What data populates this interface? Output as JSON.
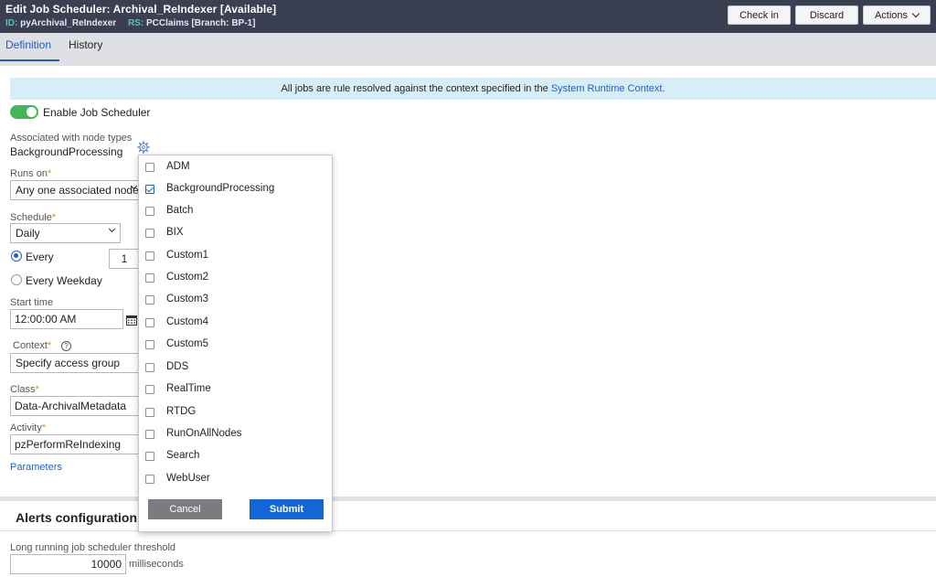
{
  "header": {
    "title": "Edit  Job Scheduler: Archival_ReIndexer [Available]",
    "id_label": "ID:",
    "id_value": "pyArchival_ReIndexer",
    "rs_label": "RS:",
    "rs_value": "PCClaims [Branch: BP-1]",
    "buttons": {
      "check_in": "Check in",
      "discard": "Discard",
      "actions": "Actions"
    }
  },
  "tabs": [
    {
      "label": "Definition",
      "active": true
    },
    {
      "label": "History",
      "active": false
    }
  ],
  "info_bar": {
    "text": "All jobs are rule resolved against the context specified in the ",
    "link": "System Runtime Context."
  },
  "form": {
    "enable_label": "Enable Job Scheduler",
    "node_types_label": "Associated with node types",
    "node_types_value": "BackgroundProcessing",
    "runs_on_label": "Runs on",
    "runs_on_value": "Any one associated node",
    "schedule_label": "Schedule",
    "schedule_value": "Daily",
    "every_label": "Every",
    "every_value": "1",
    "every_weekday_label": "Every Weekday",
    "start_time_label": "Start time",
    "start_time_value": "12:00:00 AM",
    "context_label": "Context",
    "context_help": "?",
    "context_value": "Specify access group",
    "class_label": "Class",
    "class_value": "Data-ArchivalMetadata",
    "activity_label": "Activity",
    "activity_value": "pzPerformReIndexing",
    "parameters_link": "Parameters",
    "required_mark": "*"
  },
  "alerts": {
    "title": "Alerts configuration",
    "threshold_label": "Long running job scheduler threshold",
    "threshold_value": "10000",
    "threshold_unit": "milliseconds"
  },
  "node_dropdown": {
    "options": [
      {
        "label": "ADM",
        "checked": false
      },
      {
        "label": "BackgroundProcessing",
        "checked": true
      },
      {
        "label": "Batch",
        "checked": false
      },
      {
        "label": "BIX",
        "checked": false
      },
      {
        "label": "Custom1",
        "checked": false
      },
      {
        "label": "Custom2",
        "checked": false
      },
      {
        "label": "Custom3",
        "checked": false
      },
      {
        "label": "Custom4",
        "checked": false
      },
      {
        "label": "Custom5",
        "checked": false
      },
      {
        "label": "DDS",
        "checked": false
      },
      {
        "label": "RealTime",
        "checked": false
      },
      {
        "label": "RTDG",
        "checked": false
      },
      {
        "label": "RunOnAllNodes",
        "checked": false
      },
      {
        "label": "Search",
        "checked": false
      },
      {
        "label": "WebUser",
        "checked": false
      }
    ],
    "cancel_label": "Cancel",
    "submit_label": "Submit"
  },
  "icons": {
    "gear": "gear-icon",
    "calendar": "calendar-icon",
    "chevron": "chevron-down-icon",
    "help": "help-icon"
  },
  "colors": {
    "header_bg": "#3a3f52",
    "accent": "#1d5fc9",
    "toggle_on": "#43b55a",
    "info_bg": "#d7eef8",
    "submit_bg": "#1266d6",
    "cancel_bg": "#7a7c80"
  }
}
